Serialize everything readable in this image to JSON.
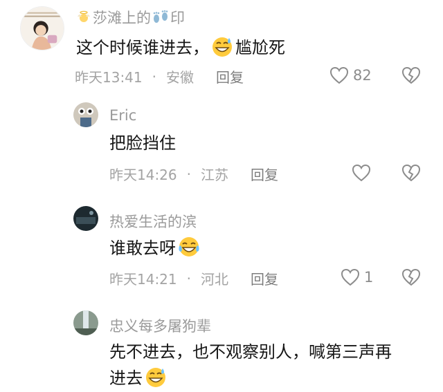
{
  "comments": [
    {
      "user": "莎滩上的",
      "user_suffix": "印",
      "text": "这个时候谁进去，",
      "text_after": "尴尬死",
      "time": "昨天13:41",
      "location": "安徽",
      "reply": "回复",
      "likes": "82"
    },
    {
      "user": "Eric",
      "text": "把脸挡住",
      "time": "昨天14:26",
      "location": "江苏",
      "reply": "回复",
      "likes": ""
    },
    {
      "user": "热爱生活的滨",
      "text": "谁敢去呀",
      "time": "昨天14:21",
      "location": "河北",
      "reply": "回复",
      "likes": "1"
    },
    {
      "user": "忠义每多屠狗辈",
      "text": "先不进去，也不观察别人，喊第三声再",
      "text_line2": "进去"
    }
  ],
  "separator": "·",
  "colors": {
    "name": "#9a9a9a",
    "meta": "#a3a3a3",
    "icon": "#8c8c8c"
  },
  "icons": [
    "angel-emoji-icon",
    "footprints-icon",
    "sweat-smile-emoji-icon",
    "tears-of-joy-emoji-icon",
    "heart-outline-icon",
    "broken-heart-icon"
  ]
}
